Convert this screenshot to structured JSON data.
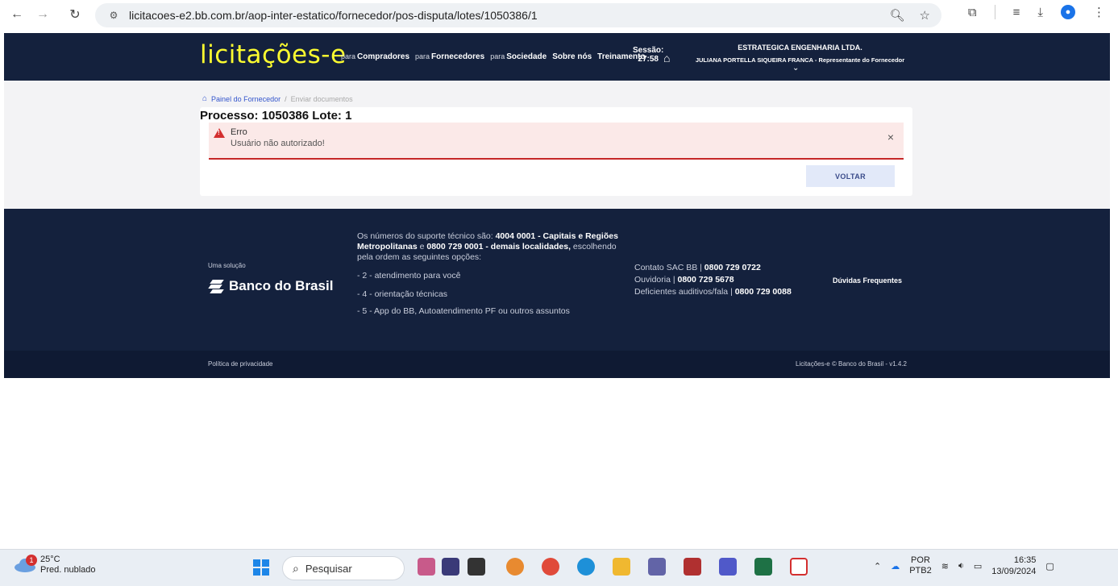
{
  "browser": {
    "url": "licitacoes-e2.bb.com.br/aop-inter-estatico/fornecedor/pos-disputa/lotes/1050386/1"
  },
  "header": {
    "logo": "licitações-e",
    "nav": [
      {
        "prefix": "para",
        "label": "Compradores"
      },
      {
        "prefix": "para",
        "label": "Fornecedores"
      },
      {
        "prefix": "para",
        "label": "Sociedade"
      },
      {
        "prefix": "",
        "label": "Sobre nós"
      },
      {
        "prefix": "",
        "label": "Treinamento"
      }
    ],
    "session_label": "Sessão:",
    "session_time": "27:58",
    "company": "ESTRATEGICA ENGENHARIA LTDA.",
    "representative": "JULIANA PORTELLA SIQUEIRA FRANCA - Representante do Fornecedor"
  },
  "breadcrumb": {
    "home": "Painel do Fornecedor",
    "separator": "/",
    "current": "Enviar documentos"
  },
  "main": {
    "title": "Processo: 1050386 Lote: 1",
    "alert_title": "Erro",
    "alert_message": "Usuário não autorizado!",
    "back_button": "VOLTAR"
  },
  "footer": {
    "solution_label": "Uma solução",
    "bank_name": "Banco do Brasil",
    "support_intro": "Os números do suporte técnico são: ",
    "support_capitals": "4004 0001 - Capitais e Regiões Metropolitanas",
    "support_and": " e ",
    "support_other": "0800 729 0001 - demais localidades,",
    "support_choose": " escolhendo pela ordem as seguintes opções:",
    "options": [
      "- 2 - atendimento para você",
      "- 4 - orientação técnicas",
      "- 5 - App do BB, Autoatendimento PF ou outros assuntos"
    ],
    "sac_label": "Contato SAC BB | ",
    "sac_number": "0800 729 0722",
    "ouvidoria_label": "Ouvidoria | ",
    "ouvidoria_number": "0800 729 5678",
    "deficientes_label": "Deficientes auditivos/fala | ",
    "deficientes_number": "0800 729 0088",
    "faq": "Dúvidas Frequentes",
    "privacy": "Política de privacidade",
    "version": "Licitações-e © Banco do Brasil - v1.4.2"
  },
  "taskbar": {
    "weather_temp": "25°C",
    "weather_desc": "Pred. nublado",
    "weather_badge": "1",
    "search_placeholder": "Pesquisar",
    "lang_top": "POR",
    "lang_bottom": "PTB2",
    "time": "16:35",
    "date": "13/09/2024"
  }
}
